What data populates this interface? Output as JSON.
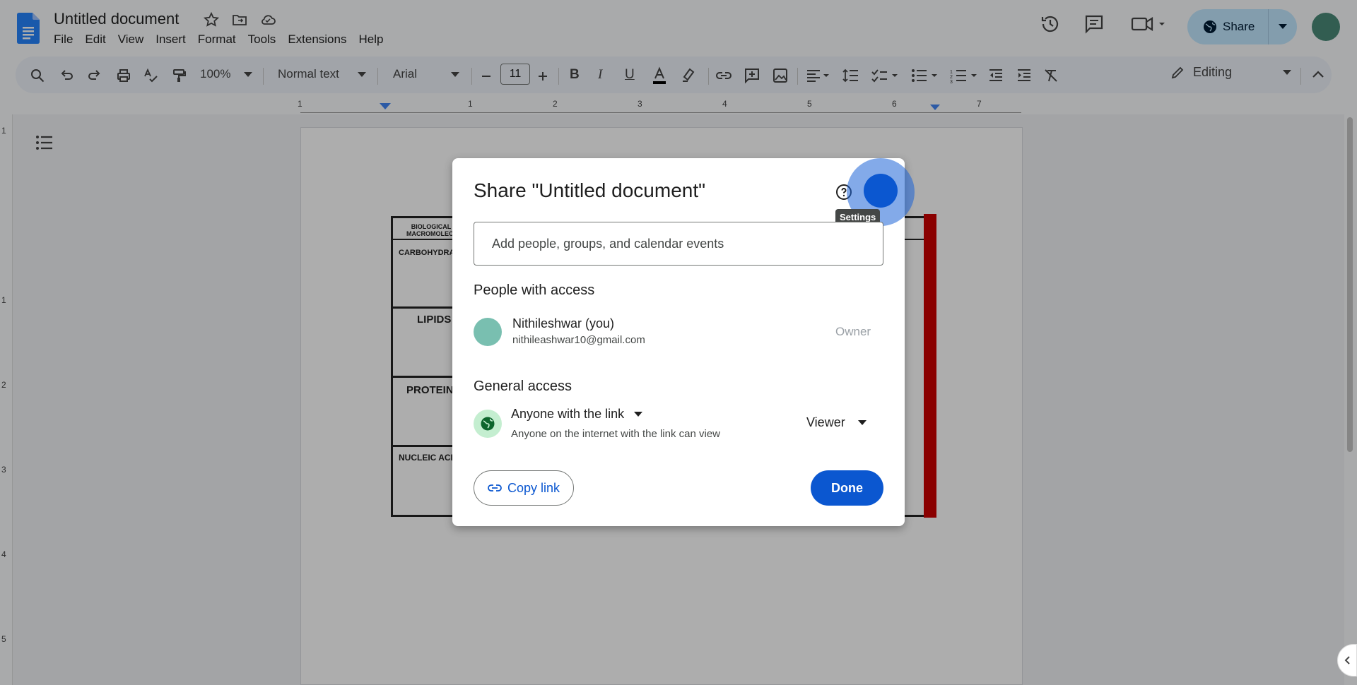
{
  "app": {
    "doc_title": "Untitled document",
    "menu": [
      "File",
      "Edit",
      "View",
      "Insert",
      "Format",
      "Tools",
      "Extensions",
      "Help"
    ],
    "share_label": "Share",
    "icons": {
      "star": "star-icon",
      "move": "folder-move-icon",
      "cloud": "cloud-saved-icon",
      "history": "history-icon",
      "comments": "comment-icon",
      "meet": "video-camera-icon"
    }
  },
  "toolbar": {
    "zoom": "100%",
    "style": "Normal text",
    "font": "Arial",
    "font_size": "11",
    "mode": "Editing"
  },
  "ruler": [
    "1",
    "1",
    "2",
    "3",
    "4",
    "5",
    "6",
    "7"
  ],
  "vruler": [
    "1",
    "1",
    "2",
    "3",
    "4",
    "5"
  ],
  "document": {
    "worksheet_title": "BIOLOGICAL MACROMOLECULES",
    "rows": [
      "CARBOHYDRATES",
      "LIPIDS",
      "PROTEINS",
      "NUCLEIC ACIDS"
    ]
  },
  "dialog": {
    "title": "Share \"Untitled document\"",
    "settings_tooltip": "Settings",
    "add_placeholder": "Add people, groups, and calendar events",
    "people_heading": "People with access",
    "person": {
      "name": "Nithileshwar (you)",
      "email": "nithileashwar10@gmail.com",
      "role": "Owner"
    },
    "general_heading": "General access",
    "access": {
      "scope": "Anyone with the link",
      "description": "Anyone on the internet with the link can view",
      "role": "Viewer"
    },
    "copy_link": "Copy link",
    "done": "Done"
  },
  "colors": {
    "accent": "#0b57d0",
    "share_bg": "#c2e7ff",
    "toolbar_bg": "#edf2fa"
  }
}
